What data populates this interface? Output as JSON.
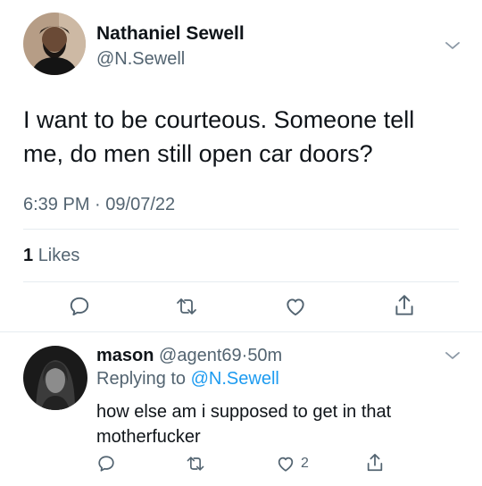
{
  "tweet": {
    "display_name": "Nathaniel Sewell",
    "handle": "@N.Sewell",
    "text_line1": "I want to be courteous. Someone tell",
    "text_line2": "me, do men still open car doors?",
    "time": "6:39 PM",
    "sep": "·",
    "date": "09/07/22",
    "likes_count": "1",
    "likes_label": "Likes",
    "actions": [
      "reply-icon",
      "retweet-icon",
      "like-icon",
      "share-icon"
    ]
  },
  "reply": {
    "display_name": "mason",
    "handle": "@agent69",
    "sep": "·",
    "age": "50m",
    "replying_prefix": "Replying to",
    "replying_to": "@N.Sewell",
    "text_line1": "how else am i supposed to get in that",
    "text_line2": "motherfucker",
    "like_count": "2"
  },
  "colors": {
    "text": "#0f1419",
    "muted": "#536471",
    "accent": "#1d9bf0",
    "divider": "#e6ecf0"
  }
}
